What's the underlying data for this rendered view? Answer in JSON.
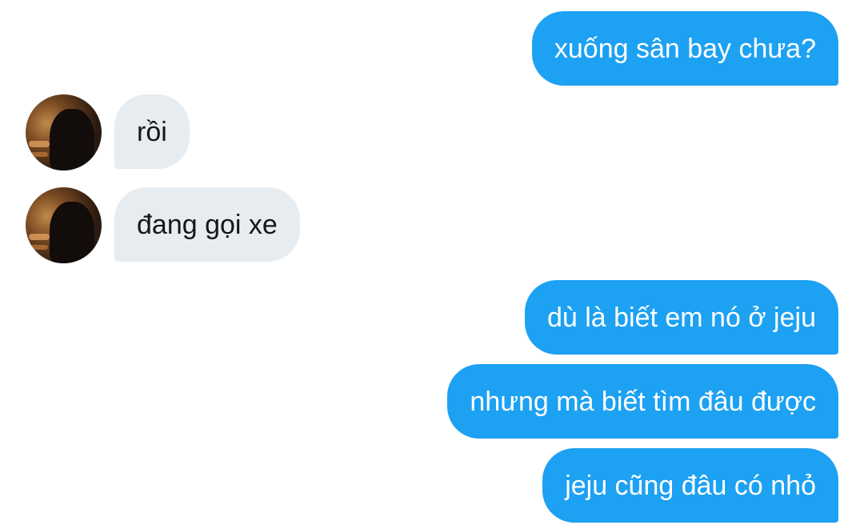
{
  "messages": [
    {
      "direction": "sent",
      "text": "xuống sân bay chưa?"
    },
    {
      "direction": "received",
      "text": "rồi",
      "avatar": "contact-avatar"
    },
    {
      "direction": "received",
      "text": "đang gọi xe",
      "avatar": "contact-avatar"
    },
    {
      "direction": "sent",
      "text": "dù là biết em nó ở jeju"
    },
    {
      "direction": "sent",
      "text": "nhưng mà biết tìm đâu được"
    },
    {
      "direction": "sent",
      "text": "jeju cũng đâu có nhỏ"
    }
  ],
  "colors": {
    "sent_bubble": "#1da1f2",
    "received_bubble": "#e6ecf0",
    "received_text": "#14171a",
    "background": "#ffffff"
  }
}
